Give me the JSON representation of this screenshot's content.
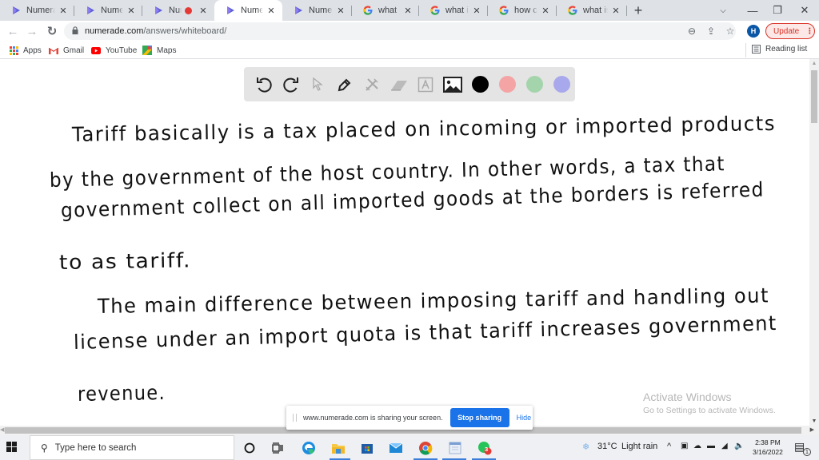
{
  "browser": {
    "tabs": [
      {
        "title": "Numerade",
        "favicon": "numerade-icon",
        "recording": false,
        "active": false
      },
      {
        "title": "Numerade",
        "favicon": "numerade-icon",
        "recording": false,
        "active": false
      },
      {
        "title": "Nume",
        "favicon": "numerade-icon",
        "recording": true,
        "active": false
      },
      {
        "title": "Numerade",
        "favicon": "numerade-icon",
        "recording": false,
        "active": true
      },
      {
        "title": "Numerade",
        "favicon": "numerade-icon",
        "recording": false,
        "active": false
      },
      {
        "title": "what happ",
        "favicon": "google-icon",
        "recording": false,
        "active": false
      },
      {
        "title": "what is m",
        "favicon": "google-icon",
        "recording": false,
        "active": false
      },
      {
        "title": "how can a",
        "favicon": "google-icon",
        "recording": false,
        "active": false
      },
      {
        "title": "what is ch",
        "favicon": "google-icon",
        "recording": false,
        "active": false
      }
    ],
    "tab_close_glyph": "✕",
    "new_tab_glyph": "+",
    "window_controls": {
      "tab_search": "⌵",
      "minimize": "—",
      "restore": "❐",
      "close": "✕"
    },
    "nav": {
      "back": "←",
      "forward": "→",
      "reload": "↻"
    },
    "url": {
      "host": "numerade.com",
      "path": "/answers/whiteboard/"
    },
    "omnibox_icons": {
      "zoom": "⊖",
      "share": "⇪",
      "star": "☆"
    },
    "profile_initial": "H",
    "update_label": "Update",
    "update_menu": "⋮",
    "bookmarks": [
      {
        "label": "Apps",
        "icon": "apps-grid-icon"
      },
      {
        "label": "Gmail",
        "icon": "gmail-icon"
      },
      {
        "label": "YouTube",
        "icon": "youtube-icon"
      },
      {
        "label": "Maps",
        "icon": "maps-icon"
      }
    ],
    "reading_list_label": "Reading list"
  },
  "whiteboard": {
    "toolbar": {
      "tools": [
        "undo",
        "redo",
        "select",
        "pen",
        "tools",
        "eraser",
        "text",
        "image"
      ],
      "colors": [
        "#000000",
        "#f4a4a4",
        "#a4d4ac",
        "#a8a8ec"
      ],
      "selected_color": "#000000"
    },
    "lines": [
      "Tariff basically is a tax placed on incoming or imported products",
      "by the government of the host country. In other words, a tax that",
      "government collect on all imported goods at the borders is referred",
      "to as tariff.",
      "The main difference between imposing tariff and handling out",
      "license under an import quota is that tariff increases government",
      "revenue."
    ]
  },
  "watermark": {
    "title": "Activate Windows",
    "subtitle": "Go to Settings to activate Windows."
  },
  "share_banner": {
    "message": "www.numerade.com is sharing your screen.",
    "stop_label": "Stop sharing",
    "hide_label": "Hide"
  },
  "taskbar": {
    "search_placeholder": "Type here to search",
    "apps": [
      "cortana",
      "task-view",
      "edge",
      "file-explorer",
      "store",
      "mail",
      "chrome",
      "calendar-app",
      "whatsapp"
    ],
    "whatsapp_badge": "3",
    "weather": {
      "temp": "31°C",
      "condition": "Light rain"
    },
    "time": "2:38 PM",
    "date": "3/16/2022",
    "notification_count": "1"
  }
}
